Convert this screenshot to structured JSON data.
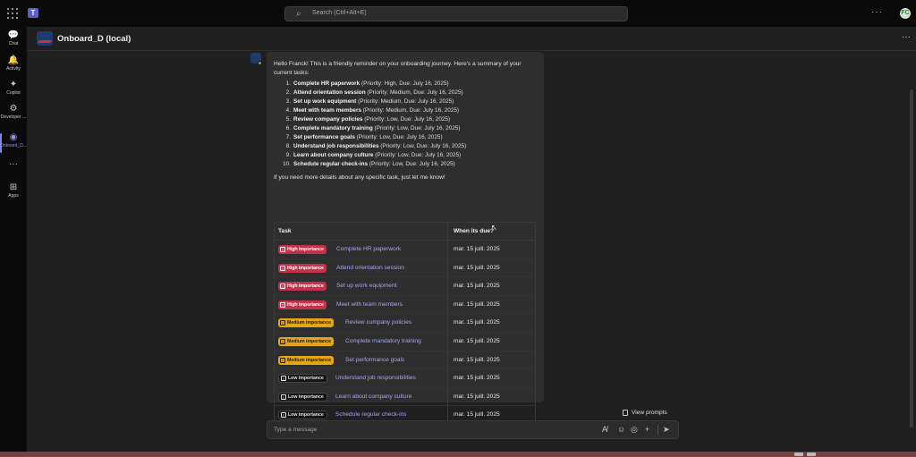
{
  "topbar": {
    "search_placeholder": "Search (Ctrl+Alt+E)",
    "more": "···",
    "avatar_initials": "FC"
  },
  "rail": {
    "items": [
      {
        "label": "Chat",
        "icon": "chat-icon",
        "glyph": "💬"
      },
      {
        "label": "Activity",
        "icon": "bell-icon",
        "glyph": "🔔"
      },
      {
        "label": "Copilot",
        "icon": "copilot-icon",
        "glyph": "✦"
      },
      {
        "label": "Developer ...",
        "icon": "developer-icon",
        "glyph": "⚙"
      },
      {
        "label": "Onboard_D...",
        "icon": "onboard-app-icon",
        "glyph": "◉"
      },
      {
        "label": "",
        "icon": "more-apps-icon",
        "glyph": "···"
      },
      {
        "label": "Apps",
        "icon": "apps-icon",
        "glyph": "⊞"
      }
    ]
  },
  "chat": {
    "title": "Onboard_D (local)",
    "header_more": "···"
  },
  "message": {
    "intro": "Hello Franck! This is a friendly reminder on your onboarding journey. Here's a summary of your current tasks:",
    "tasks": [
      {
        "n": "1.",
        "name": "Complete HR paperwork",
        "details": " (Priority: High, Due: July 16, 2025)"
      },
      {
        "n": "2.",
        "name": "Attend orientation session",
        "details": " (Priority: Medium, Due: July 16, 2025)"
      },
      {
        "n": "3.",
        "name": "Set up work equipment",
        "details": " (Priority: Medium, Due: July 16, 2025)"
      },
      {
        "n": "4.",
        "name": "Meet with team members",
        "details": " (Priority: Medium, Due: July 16, 2025)"
      },
      {
        "n": "5.",
        "name": "Review company policies",
        "details": " (Priority: Low, Due: July 16, 2025)"
      },
      {
        "n": "6.",
        "name": "Complete mandatory training",
        "details": " (Priority: Low, Due: July 16, 2025)"
      },
      {
        "n": "7.",
        "name": "Set performance goals",
        "details": " (Priority: Low, Due: July 16, 2025)"
      },
      {
        "n": "8.",
        "name": "Understand job responsibilities",
        "details": " (Priority: Low, Due: July 16, 2025)"
      },
      {
        "n": "9.",
        "name": "Learn about company culture",
        "details": " (Priority: Low, Due: July 16, 2025)"
      },
      {
        "n": "10.",
        "name": "Schedule regular check-ins",
        "details": " (Priority: Low, Due: July 16, 2025)"
      }
    ],
    "outro": "If you need more details about any specific task, just let me know!"
  },
  "table": {
    "col_task": "Task",
    "col_due": "When its due?",
    "rows": [
      {
        "badge": "High importance",
        "level": "high",
        "task": "Complete HR paperwork",
        "due": "mar. 15 juill. 2025"
      },
      {
        "badge": "High importance",
        "level": "high",
        "task": "Attend orientation session",
        "due": "mar. 15 juill. 2025"
      },
      {
        "badge": "High importance",
        "level": "high",
        "task": "Set up work equipment",
        "due": "mar. 15 juill. 2025"
      },
      {
        "badge": "High importance",
        "level": "high",
        "task": "Meet with team members",
        "due": "mar. 15 juill. 2025"
      },
      {
        "badge": "Medium importance",
        "level": "medium",
        "task": "Review company policies",
        "due": "mar. 15 juill. 2025"
      },
      {
        "badge": "Medium importance",
        "level": "medium",
        "task": "Complete mandatory training",
        "due": "mar. 15 juill. 2025"
      },
      {
        "badge": "Medium importance",
        "level": "medium",
        "task": "Set performance goals",
        "due": "mar. 15 juill. 2025"
      },
      {
        "badge": "Low importance",
        "level": "low",
        "task": "Understand job responsibilities",
        "due": "mar. 15 juill. 2025"
      },
      {
        "badge": "Low importance",
        "level": "low",
        "task": "Learn about company culture",
        "due": "mar. 15 juill. 2025"
      },
      {
        "badge": "Low importance",
        "level": "low",
        "task": "Schedule regular check-ins",
        "due": "mar. 15 juill. 2025"
      }
    ]
  },
  "composer": {
    "view_prompts": "View prompts",
    "placeholder": "Type a message"
  },
  "colors": {
    "high": "#c4314b",
    "medium": "#e5a614",
    "low": "#141414",
    "link": "#a6a8f0",
    "accent": "#7f85f5"
  }
}
